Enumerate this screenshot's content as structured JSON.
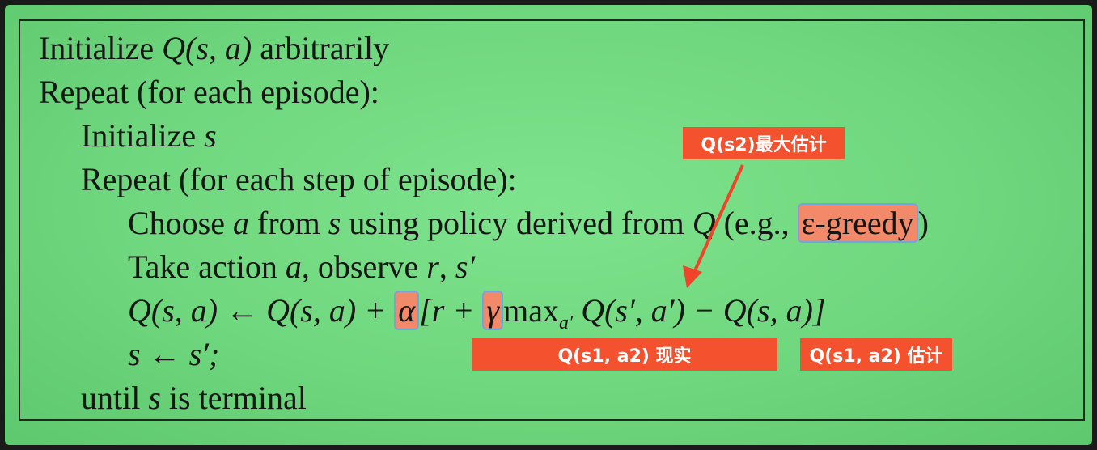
{
  "algorithm": {
    "init_q": {
      "pre": "Initialize ",
      "math": "Q(s, a)",
      "post": " arbitrarily"
    },
    "repeat_episode": "Repeat (for each episode):",
    "init_s": {
      "pre": "Initialize ",
      "math": "s"
    },
    "repeat_step": "Repeat (for each step of episode):",
    "choose": {
      "w1": "Choose ",
      "m1": "a",
      "w2": " from ",
      "m2": "s",
      "w3": " using policy derived from ",
      "m3": "Q",
      "w4": " (e.g., ",
      "hl": "ε-greedy",
      "w5": ")"
    },
    "take": {
      "w1": "Take action ",
      "m1": "a",
      "w2": ", observe ",
      "m2": "r",
      "w3": ", ",
      "m3": "s′"
    },
    "update": {
      "p1": "Q(s, a) ← Q(s, a) + ",
      "alpha": "α",
      "p2": "[r + ",
      "gamma": "γ",
      "max": "max",
      "maxsub": "a′",
      "p3": " Q(s′, a′) − Q(s, a)]"
    },
    "assign": "s ← s′;",
    "until": {
      "pre": "until ",
      "math": "s",
      "post": " is terminal"
    }
  },
  "annotations": {
    "max_estimate": "Q(s2)最大估计",
    "reality": "Q(s1, a2) 现实",
    "estimate": "Q(s1, a2) 估计"
  },
  "colors": {
    "background_green": "#6fd77e",
    "highlight": "#f28a6a",
    "highlight_border": "#7aa2d8",
    "label_red": "#f4512f",
    "arrow_red": "#f0442a"
  }
}
